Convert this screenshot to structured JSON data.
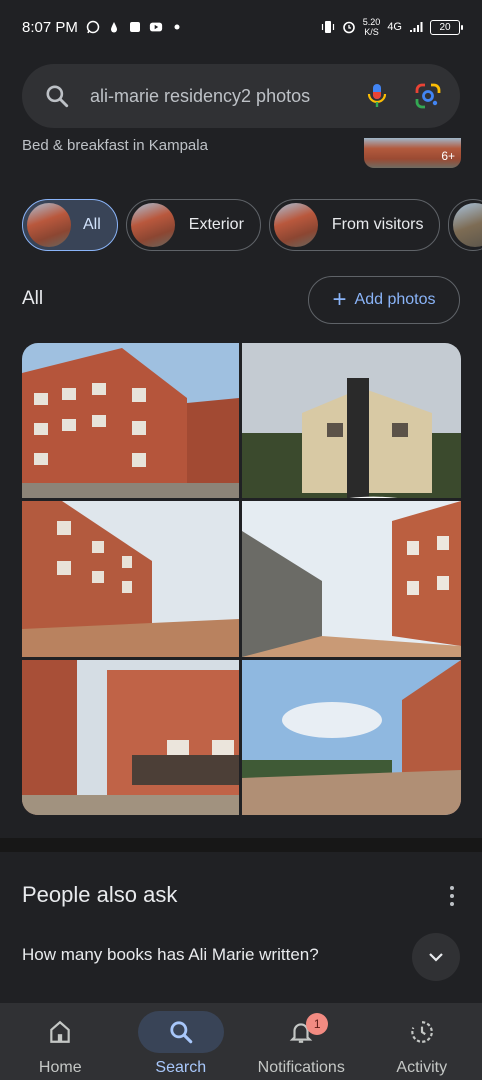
{
  "status_bar": {
    "time": "8:07 PM",
    "net_speed_value": "5.20",
    "net_speed_unit": "K/S",
    "network": "4G",
    "battery": "20"
  },
  "search": {
    "query": "ali-marie residency2 photos"
  },
  "place": {
    "subtitle": "Bed & breakfast in Kampala",
    "more_photos": "6+"
  },
  "chips": [
    {
      "label": "All",
      "active": true
    },
    {
      "label": "Exterior"
    },
    {
      "label": "From visitors"
    }
  ],
  "section": {
    "title": "All",
    "add_photos_label": "Add photos"
  },
  "people_also_ask": {
    "title": "People also ask",
    "questions": [
      "How many books has Ali Marie written?"
    ]
  },
  "bottom_nav": [
    {
      "label": "Home",
      "icon": "home-icon"
    },
    {
      "label": "Search",
      "icon": "search-icon",
      "active": true
    },
    {
      "label": "Notifications",
      "icon": "bell-icon",
      "badge": "1"
    },
    {
      "label": "Activity",
      "icon": "activity-icon"
    }
  ],
  "colors": {
    "background": "#202124",
    "accent": "#8ab4f8",
    "badge": "#f28b82"
  }
}
